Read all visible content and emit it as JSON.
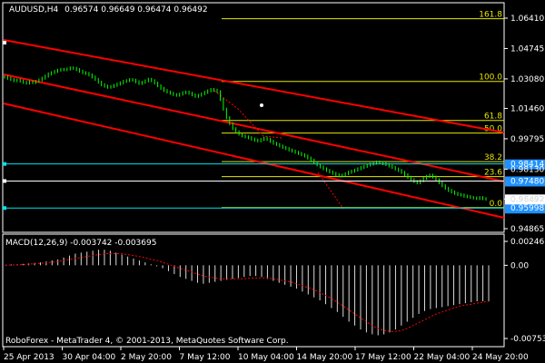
{
  "header": {
    "symbol": "AUDUSD,H4",
    "ohlc": "0.96574 0.96649 0.96474 0.96492"
  },
  "price_axis": {
    "ticks": [
      "1.06410",
      "1.04745",
      "1.03080",
      "1.01460",
      "0.99795",
      "0.98130",
      "0.96492",
      "0.94865"
    ],
    "marked": [
      {
        "label": "0.98414",
        "bg": "#1e90ff"
      },
      {
        "label": "0.97480",
        "bg": "#1e90ff"
      },
      {
        "label": "0.95998",
        "bg": "#1e90ff"
      }
    ],
    "current": {
      "label": "0.96492",
      "bg": "#ffffff"
    }
  },
  "fibonacci": {
    "color": "#e6e600",
    "levels": [
      {
        "label": "161.8"
      },
      {
        "label": "100.0"
      },
      {
        "label": "61.8"
      },
      {
        "label": "50.0"
      },
      {
        "label": "38.2"
      },
      {
        "label": "23.6"
      },
      {
        "label": "0.0"
      }
    ]
  },
  "channel": {
    "color": "#ff0000"
  },
  "macd": {
    "label": "MACD(12,26,9) -0.003742 -0.003695",
    "axis_ticks": [
      "0.00246",
      "0.00",
      "-0.00753"
    ],
    "histogram": [
      5e-05,
      8e-05,
      0.0001,
      0.00015,
      0.0002,
      0.00025,
      0.0003,
      0.0004,
      0.0005,
      0.0006,
      0.0008,
      0.001,
      0.0012,
      0.0013,
      0.0014,
      0.0015,
      0.0016,
      0.0016,
      0.0015,
      0.0013,
      0.0011,
      0.0009,
      0.0007,
      0.0005,
      0.0003,
      0.0001,
      -0.0001,
      -0.0003,
      -0.0006,
      -0.0009,
      -0.0012,
      -0.0014,
      -0.0016,
      -0.0018,
      -0.0019,
      -0.0018,
      -0.0017,
      -0.0016,
      -0.0015,
      -0.0014,
      -0.0013,
      -0.0012,
      -0.0011,
      -0.0011,
      -0.0012,
      -0.0014,
      -0.0016,
      -0.0018,
      -0.002,
      -0.0022,
      -0.0024,
      -0.0027,
      -0.003,
      -0.0033,
      -0.0036,
      -0.004,
      -0.0044,
      -0.0048,
      -0.0053,
      -0.0058,
      -0.0062,
      -0.0066,
      -0.0069,
      -0.0071,
      -0.0072,
      -0.0071,
      -0.0069,
      -0.0066,
      -0.0062,
      -0.0058,
      -0.0054,
      -0.005,
      -0.0047,
      -0.0045,
      -0.0044,
      -0.0043,
      -0.0042,
      -0.0041,
      -0.004,
      -0.0039,
      -0.0038,
      -0.0037,
      -0.0037,
      -0.0037
    ],
    "signal": [
      0.0,
      2e-05,
      5e-05,
      8e-05,
      0.00012,
      0.00016,
      0.0002,
      0.00026,
      0.00032,
      0.0004,
      0.0005,
      0.0006,
      0.0007,
      0.0008,
      0.0009,
      0.001,
      0.0011,
      0.0012,
      0.0012,
      0.0012,
      0.0012,
      0.0011,
      0.001,
      0.0009,
      0.0008,
      0.0006,
      0.0005,
      0.0003,
      0.0001,
      -0.0001,
      -0.0003,
      -0.0005,
      -0.0007,
      -0.0009,
      -0.0011,
      -0.0012,
      -0.0013,
      -0.0014,
      -0.0014,
      -0.0014,
      -0.0014,
      -0.0014,
      -0.0013,
      -0.0013,
      -0.0013,
      -0.0013,
      -0.0014,
      -0.0015,
      -0.0016,
      -0.0017,
      -0.0019,
      -0.0021,
      -0.0023,
      -0.0025,
      -0.0028,
      -0.0031,
      -0.0034,
      -0.0038,
      -0.0042,
      -0.0046,
      -0.005,
      -0.0054,
      -0.0058,
      -0.0062,
      -0.0065,
      -0.0067,
      -0.0068,
      -0.0068,
      -0.0067,
      -0.0065,
      -0.0062,
      -0.0059,
      -0.0056,
      -0.0053,
      -0.005,
      -0.0048,
      -0.0046,
      -0.0044,
      -0.0042,
      -0.0041,
      -0.004,
      -0.0039,
      -0.0038,
      -0.0037
    ]
  },
  "time_axis": {
    "labels": [
      "25 Apr 2013",
      "30 Apr 04:00",
      "2 May 20:00",
      "7 May 12:00",
      "10 May 04:00",
      "14 May 20:00",
      "17 May 12:00",
      "22 May 04:00",
      "24 May 20:00"
    ]
  },
  "footer": {
    "copyright": "RoboForex - MetaTrader 4, © 2001-2013, MetaQuotes Software Corp."
  },
  "series": {
    "close": [
      1.0318,
      1.0312,
      1.0305,
      1.0298,
      1.0301,
      1.0296,
      1.0289,
      1.0285,
      1.0292,
      1.0288,
      1.0294,
      1.0302,
      1.0312,
      1.0323,
      1.0335,
      1.0342,
      1.0349,
      1.0355,
      1.036,
      1.0358,
      1.0362,
      1.0368,
      1.0366,
      1.0359,
      1.035,
      1.0342,
      1.0338,
      1.033,
      1.0318,
      1.0305,
      1.029,
      1.0276,
      1.0268,
      1.0262,
      1.0266,
      1.0272,
      1.0279,
      1.0286,
      1.0294,
      1.0298,
      1.0304,
      1.0301,
      1.0292,
      1.0283,
      1.0289,
      1.0297,
      1.0306,
      1.0298,
      1.0285,
      1.027,
      1.0256,
      1.0244,
      1.0236,
      1.0229,
      1.0222,
      1.0218,
      1.0224,
      1.0232,
      1.0236,
      1.0229,
      1.022,
      1.0212,
      1.0218,
      1.0226,
      1.0234,
      1.0242,
      1.025,
      1.0246,
      1.0238,
      1.0195,
      1.0142,
      1.0095,
      1.0062,
      1.0035,
      1.0018,
      1.0005,
      0.9995,
      0.999,
      0.9985,
      0.9978,
      0.9972,
      0.9968,
      0.9975,
      0.9983,
      0.9976,
      0.9965,
      0.9955,
      0.9948,
      0.994,
      0.9932,
      0.9926,
      0.9918,
      0.9912,
      0.9905,
      0.9899,
      0.9892,
      0.9885,
      0.9874,
      0.9862,
      0.9848,
      0.9836,
      0.9825,
      0.9815,
      0.9806,
      0.9798,
      0.979,
      0.9782,
      0.9776,
      0.978,
      0.9788,
      0.9796,
      0.9802,
      0.9808,
      0.9815,
      0.9822,
      0.9828,
      0.9835,
      0.984,
      0.9846,
      0.9852,
      0.9848,
      0.9843,
      0.9838,
      0.983,
      0.9822,
      0.9814,
      0.9806,
      0.9795,
      0.9782,
      0.9768,
      0.9755,
      0.9745,
      0.9738,
      0.9749,
      0.9762,
      0.9773,
      0.978,
      0.977,
      0.9755,
      0.9738,
      0.9722,
      0.9708,
      0.9696,
      0.9688,
      0.968,
      0.9674,
      0.9671,
      0.9665,
      0.9662,
      0.9658,
      0.9655,
      0.9652,
      0.9657,
      0.9651,
      0.9649
    ]
  }
}
